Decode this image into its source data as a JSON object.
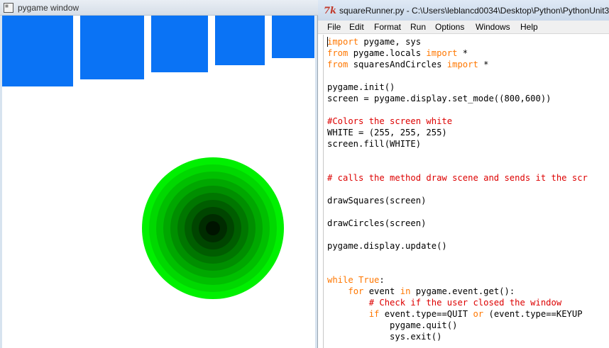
{
  "pygame_window": {
    "title": "pygame window",
    "canvas_bg": "#ffffff",
    "square_color": "#0a73f5",
    "squares": [
      {
        "size": 100
      },
      {
        "size": 90
      },
      {
        "size": 80
      },
      {
        "size": 70
      },
      {
        "size": 60
      }
    ],
    "circle_rings": 10,
    "circle_outer_color": "#00f000",
    "circle_inner_color": "#001400"
  },
  "idle_window": {
    "title": "squareRunner.py - C:\\Users\\leblancd0034\\Desktop\\Python\\PythonUnit3\\",
    "icon": "tk-feather-icon",
    "menu": [
      "File",
      "Edit",
      "Format",
      "Run",
      "Options",
      "Windows",
      "Help"
    ],
    "code_lines": [
      [
        {
          "t": "import",
          "k": "kw"
        },
        {
          "t": " pygame, sys"
        }
      ],
      [
        {
          "t": "from",
          "k": "kw"
        },
        {
          "t": " pygame.locals "
        },
        {
          "t": "import",
          "k": "kw"
        },
        {
          "t": " *"
        }
      ],
      [
        {
          "t": "from",
          "k": "kw"
        },
        {
          "t": " squaresAndCircles "
        },
        {
          "t": "import",
          "k": "kw"
        },
        {
          "t": " *"
        }
      ],
      [],
      [
        {
          "t": "pygame.init()"
        }
      ],
      [
        {
          "t": "screen = pygame.display.set_mode((800,600))"
        }
      ],
      [],
      [
        {
          "t": "#Colors the screen white",
          "k": "cm"
        }
      ],
      [
        {
          "t": "WHITE = (255, 255, 255)"
        }
      ],
      [
        {
          "t": "screen.fill(WHITE)"
        }
      ],
      [],
      [],
      [
        {
          "t": "# calls the method draw scene and sends it the scr",
          "k": "cm"
        }
      ],
      [],
      [
        {
          "t": "drawSquares(screen)"
        }
      ],
      [],
      [
        {
          "t": "drawCircles(screen)"
        }
      ],
      [],
      [
        {
          "t": "pygame.display.update()"
        }
      ],
      [],
      [],
      [
        {
          "t": "while",
          "k": "kw"
        },
        {
          "t": " "
        },
        {
          "t": "True",
          "k": "kw"
        },
        {
          "t": ":"
        }
      ],
      [
        {
          "t": "    "
        },
        {
          "t": "for",
          "k": "kw"
        },
        {
          "t": " event "
        },
        {
          "t": "in",
          "k": "kw"
        },
        {
          "t": " pygame.event.get():"
        }
      ],
      [
        {
          "t": "        "
        },
        {
          "t": "# Check if the user closed the window",
          "k": "cm"
        }
      ],
      [
        {
          "t": "        "
        },
        {
          "t": "if",
          "k": "kw"
        },
        {
          "t": " event.type==QUIT "
        },
        {
          "t": "or",
          "k": "kw"
        },
        {
          "t": " (event.type==KEYUP"
        }
      ],
      [
        {
          "t": "            pygame.quit()"
        }
      ],
      [
        {
          "t": "            sys.exit()"
        }
      ]
    ]
  }
}
